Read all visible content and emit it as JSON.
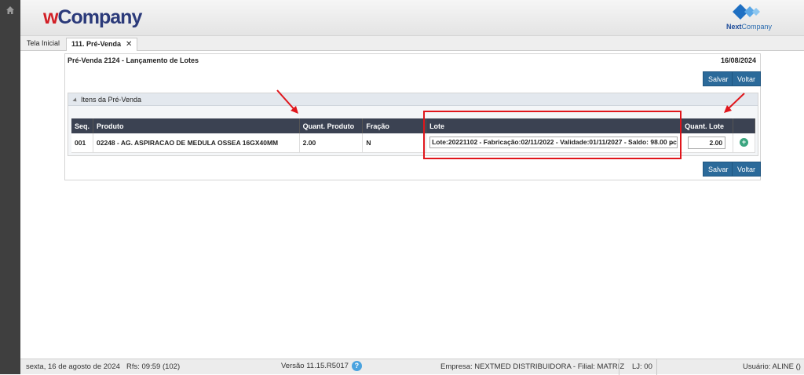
{
  "header": {
    "brand_w": "w",
    "brand_rest": "Company",
    "partner_a": "Next",
    "partner_b": "Company"
  },
  "tabs": {
    "home": "Tela Inicial",
    "prevenda": "111. Pré-Venda",
    "close": "✕"
  },
  "panel": {
    "title": "Pré-Venda 2124 - Lançamento de Lotes",
    "date": "16/08/2024",
    "save_label": "Salvar",
    "back_label": "Voltar"
  },
  "section": {
    "title": "Itens da Pré-Venda"
  },
  "table": {
    "headers": [
      "Seq.",
      "Produto",
      "Quant. Produto",
      "Fração",
      "Lote",
      "Quant. Lote",
      ""
    ],
    "row": {
      "seq": "001",
      "produto": "02248 - AG. ASPIRACAO DE MEDULA OSSEA 16GX40MM",
      "quant_produto": "2.00",
      "fracao": "N",
      "lote": "Lote:20221102 - Fabricação:02/11/2022 - Validade:01/11/2027 - Saldo: 98.00 pc",
      "quant_lote": "2.00",
      "add": "+"
    }
  },
  "status": {
    "date": "sexta, 16 de agosto de 2024",
    "rfs": "Rfs: 09:59 (102)",
    "version": "Versão 11.15.R5017",
    "help": "?",
    "empresa": "Empresa: NEXTMED DISTRIBUIDORA - Filial: MATRIZ",
    "lj": "LJ: 00",
    "user": "Usuário: ALINE ()"
  },
  "colors": {
    "accent": "#2b6a9a",
    "highlight": "#e0161c",
    "table_header": "#3b4252"
  }
}
